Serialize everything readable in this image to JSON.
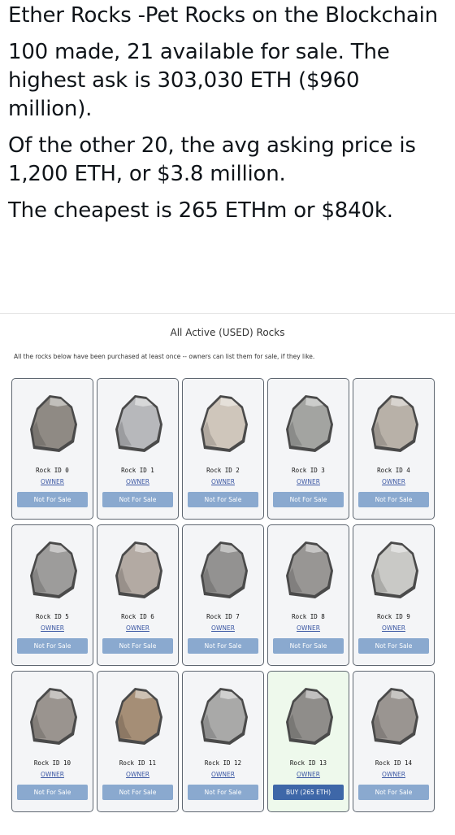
{
  "tweet": {
    "title": "Ether Rocks -Pet Rocks on the Blockchain",
    "p1": "100 made, 21 available for sale. The highest ask is 303,030 ETH ($960 million).",
    "p2": "Of the other 20, the avg asking price is 1,200 ETH, or $3.8 million.",
    "p3": "The cheapest is 265 ETHm or $840k."
  },
  "screenshot": {
    "title": "All Active (USED) Rocks",
    "subtitle": "All the rocks below have been purchased at least once -- owners can list them for sale, if they like."
  },
  "rocks": [
    {
      "id": "Rock ID 0",
      "owner": "OWNER",
      "status": "Not For Sale",
      "color": "#8f8a84"
    },
    {
      "id": "Rock ID 1",
      "owner": "OWNER",
      "status": "Not For Sale",
      "color": "#b7b8bb"
    },
    {
      "id": "Rock ID 2",
      "owner": "OWNER",
      "status": "Not For Sale",
      "color": "#cfc6bb"
    },
    {
      "id": "Rock ID 3",
      "owner": "OWNER",
      "status": "Not For Sale",
      "color": "#a3a4a1"
    },
    {
      "id": "Rock ID 4",
      "owner": "OWNER",
      "status": "Not For Sale",
      "color": "#b8b1a8"
    },
    {
      "id": "Rock ID 5",
      "owner": "OWNER",
      "status": "Not For Sale",
      "color": "#9d9c9b"
    },
    {
      "id": "Rock ID 6",
      "owner": "OWNER",
      "status": "Not For Sale",
      "color": "#b3aaa3"
    },
    {
      "id": "Rock ID 7",
      "owner": "OWNER",
      "status": "Not For Sale",
      "color": "#939291"
    },
    {
      "id": "Rock ID 8",
      "owner": "OWNER",
      "status": "Not For Sale",
      "color": "#989694"
    },
    {
      "id": "Rock ID 9",
      "owner": "OWNER",
      "status": "Not For Sale",
      "color": "#c9c9c6"
    },
    {
      "id": "Rock ID 10",
      "owner": "OWNER",
      "status": "Not For Sale",
      "color": "#9a948f"
    },
    {
      "id": "Rock ID 11",
      "owner": "OWNER",
      "status": "Not For Sale",
      "color": "#a58e76"
    },
    {
      "id": "Rock ID 12",
      "owner": "OWNER",
      "status": "Not For Sale",
      "color": "#a9a9a8"
    },
    {
      "id": "Rock ID 13",
      "owner": "OWNER",
      "status": "BUY (265 ETH)",
      "color": "#8f8d8a"
    },
    {
      "id": "Rock ID 14",
      "owner": "OWNER",
      "status": "Not For Sale",
      "color": "#9a9591"
    }
  ],
  "colors": {
    "button": "#8aa9cf",
    "buy_button": "#3e67a8",
    "link": "#3b57a3",
    "for_sale_card": "#eef9ec"
  }
}
